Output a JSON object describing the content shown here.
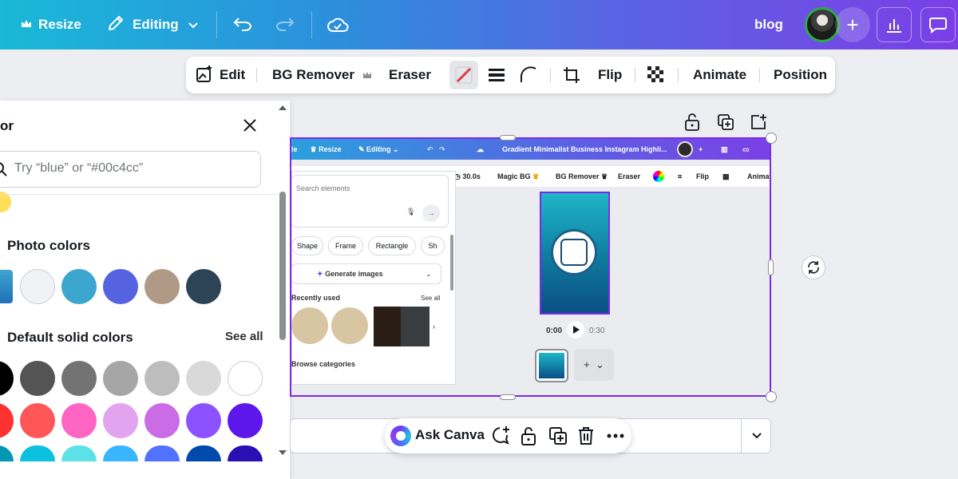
{
  "topbar": {
    "resize_label": "Resize",
    "editing_label": "Editing",
    "blog_label": "blog",
    "plus_label": "+"
  },
  "context_toolbar": {
    "edit_label": "Edit",
    "bg_remover_label": "BG Remover",
    "eraser_label": "Eraser",
    "flip_label": "Flip",
    "animate_label": "Animate",
    "position_label": "Position"
  },
  "color_panel": {
    "title": "or",
    "search_placeholder": "Try “blue” or “#00c4cc”",
    "photo_colors_heading": "Photo colors",
    "photo_colors": [
      "#f1f2f5",
      "#3da6cf",
      "#5563e0",
      "#b09a86",
      "#2d4456"
    ],
    "default_colors_heading": "Default solid colors",
    "see_all_label": "See all",
    "default_row1": [
      "#000000",
      "#545454",
      "#737373",
      "#a6a6a6",
      "#bdbdbd",
      "#d9d9d9",
      "#ffffff"
    ],
    "default_row2": [
      "#ff3131",
      "#ff5757",
      "#ff66c4",
      "#e2a4ef",
      "#cb6ce6",
      "#8c52ff",
      "#5e17eb"
    ],
    "default_row3": [
      "#0097b2",
      "#0cc0df",
      "#5ce1e6",
      "#38b6ff",
      "#5271ff",
      "#004aad",
      "#2a0fb3"
    ]
  },
  "embedded": {
    "resize": "Resize",
    "editing": "Editing",
    "doc_title": "Gradient Minimalist Business Instagram Highli...",
    "duration": "30.0s",
    "magic_bg": "Magic BG",
    "bg_remover": "BG Remover",
    "eraser": "Eraser",
    "flip": "Flip",
    "animate": "Animat",
    "search_placeholder": "Search elements",
    "chip_shape": "Shape",
    "chip_frame": "Frame",
    "chip_rectangle": "Rectangle",
    "chip_more": "Sh",
    "generate_images": "Generate images",
    "recently_used": "Recently used",
    "see_all": "See all",
    "browse_categories": "Browse categories",
    "time_start": "0:00",
    "time_end": "0:30"
  },
  "bottom": {
    "ask_canva_label": "Ask Canva"
  },
  "colors": {
    "selection": "#7d2ae8",
    "topbar_start": "#19b9d8",
    "topbar_end": "#7b3fe6"
  }
}
